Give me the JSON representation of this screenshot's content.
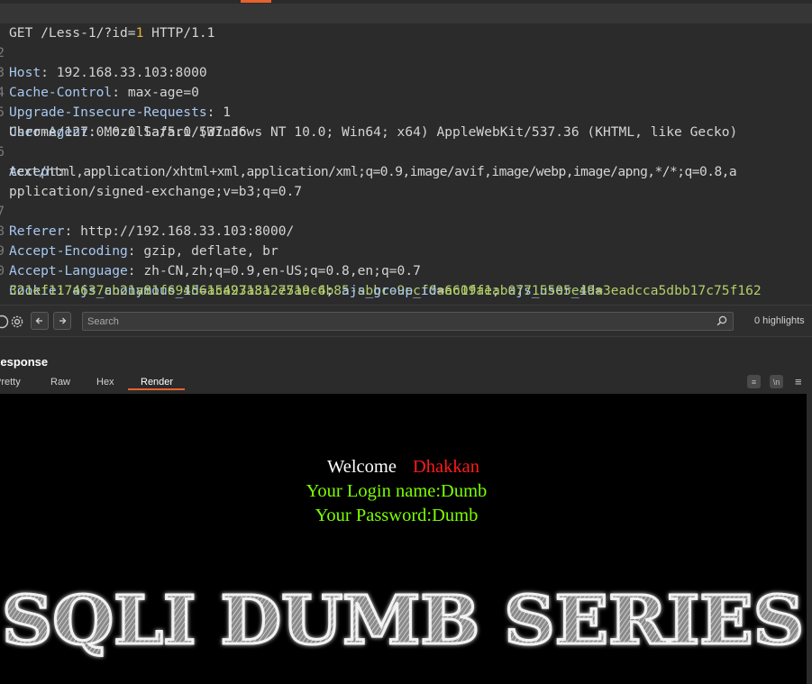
{
  "request": {
    "lines": [
      {
        "n": "",
        "key": "GET /Less-1/?id=",
        "hl": "1",
        "rest": " HTTP/1.1"
      },
      {
        "n": "2",
        "key": "Host",
        "val": "192.168.33.103:8000"
      },
      {
        "n": "3",
        "key": "Cache-Control",
        "val": "max-age=0"
      },
      {
        "n": "4",
        "key": "Upgrade-Insecure-Requests",
        "val": "1"
      },
      {
        "n": "5",
        "key": "User-Agent",
        "val": "Mozilla/5.0 (Windows NT 10.0; Win64; x64) AppleWebKit/537.36 (KHTML, like Gecko)"
      },
      {
        "n": "",
        "cont": "Chrome/127.0.0.0 Safari/537.36"
      },
      {
        "n": "6",
        "key": "Accept",
        "val": ""
      },
      {
        "n": "",
        "cont": "text/html,application/xhtml+xml,application/xml;q=0.9,image/avif,image/webp,image/apng,*/*;q=0.8,a"
      },
      {
        "n": "",
        "cont": "pplication/signed-exchange;v=b3;q=0.7"
      },
      {
        "n": "7",
        "key": "Referer",
        "val": "http://192.168.33.103:8000/"
      },
      {
        "n": "8",
        "key": "Accept-Encoding",
        "val": "gzip, deflate, br"
      },
      {
        "n": "9",
        "key": "Accept-Language",
        "val": "zh-CN,zh;q=0.9,en-US;q=0.8,en;q=0.7"
      },
      {
        "n": "0",
        "key": "Cookie",
        "cookie1_k": "ajs_anonymous_id",
        "cookie1_v": "a5497131-771e-4b85-abbc-9ecf0aac1fae",
        "cookie2_k": "ajs_user_id"
      },
      {
        "n": "",
        "cookie2_v": "321ef1174637cb21a81f694561ca23a8a2e5a9c6",
        "cookie3_k": "ajs_group_id",
        "cookie3_v": "6609f1ab07715505e49a3eadcca5dbb17c75f162"
      },
      {
        "n": "",
        "key": "Connection",
        "val": "close"
      }
    ]
  },
  "search": {
    "placeholder": "Search",
    "highlights": "0 highlights"
  },
  "response": {
    "title": "Response",
    "tabs": [
      "Pretty",
      "Raw",
      "Hex",
      "Render"
    ],
    "active_tab": "Render"
  },
  "page": {
    "welcome": "Welcome",
    "name": "Dhakkan",
    "login": "Your Login name:Dumb",
    "password": "Your Password:Dumb",
    "banner_text": "SQLI DUMB SERIES"
  },
  "colors": {
    "accent": "#e8622c",
    "name_red": "#ff1a1a",
    "login_green": "#7cff00",
    "cookie_value": "#b3cf6a",
    "header_key": "#a8c8f0",
    "param_highlight": "#e6b13a"
  },
  "icons": [
    "help-icon",
    "gear-icon",
    "arrow-left-icon",
    "arrow-right-icon",
    "search-icon",
    "wrap-icon",
    "newline-icon",
    "menu-icon"
  ]
}
